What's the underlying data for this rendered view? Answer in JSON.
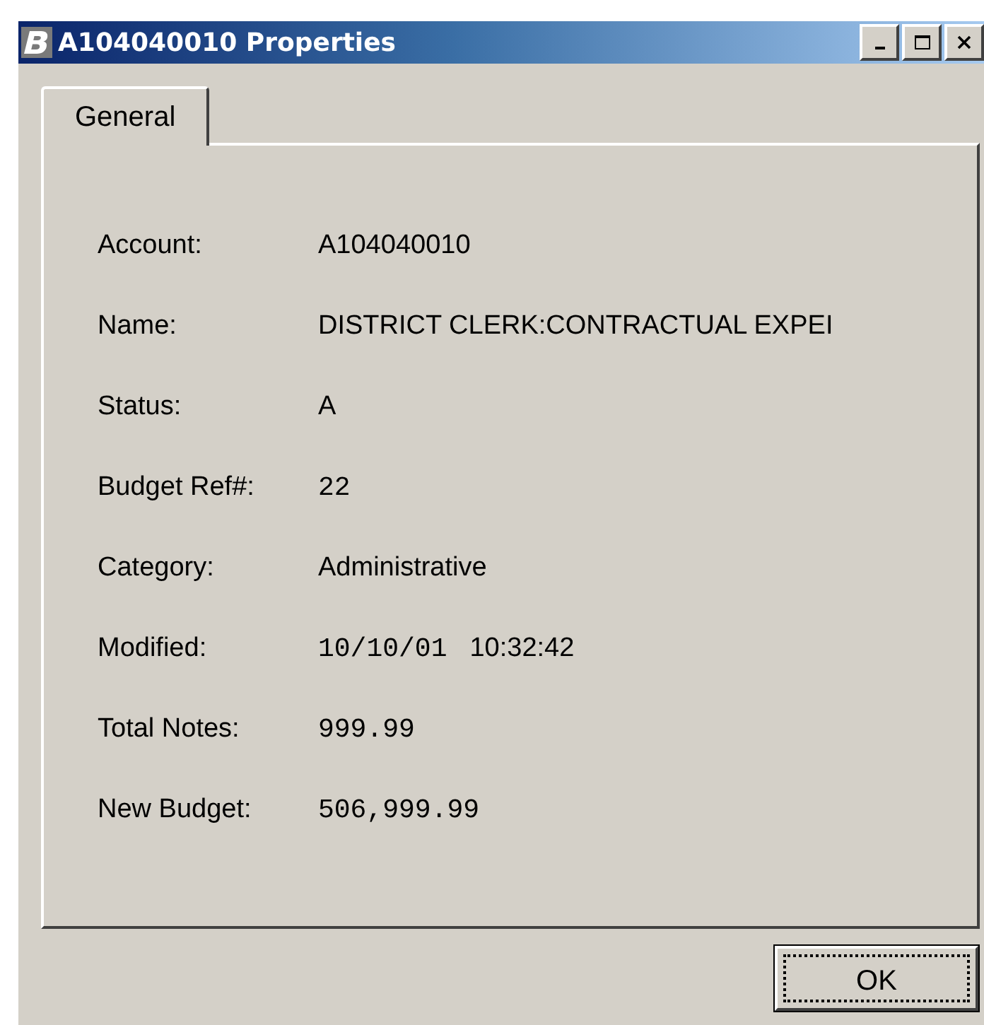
{
  "window": {
    "title": "A104040010 Properties"
  },
  "tabs": [
    {
      "label": "General",
      "selected": true
    }
  ],
  "fields": [
    {
      "label": "Account:",
      "values": [
        {
          "text": "A104040010",
          "kind": "sans"
        }
      ]
    },
    {
      "label": "Name:",
      "values": [
        {
          "text": "DISTRICT CLERK:CONTRACTUAL EXPEI",
          "kind": "sans"
        }
      ]
    },
    {
      "label": "Status:",
      "values": [
        {
          "text": "A",
          "kind": "sans"
        }
      ]
    },
    {
      "label": "Budget Ref#:",
      "values": [
        {
          "text": "22",
          "kind": "mono"
        }
      ]
    },
    {
      "label": "Category:",
      "values": [
        {
          "text": "Administrative",
          "kind": "sans"
        }
      ]
    },
    {
      "label": "Modified:",
      "values": [
        {
          "text": "10/10/01",
          "kind": "mono"
        },
        {
          "text": "10:32:42",
          "kind": "sans"
        }
      ]
    },
    {
      "label": "Total Notes:",
      "values": [
        {
          "text": "999.99",
          "kind": "mono"
        }
      ]
    },
    {
      "label": "New Budget:",
      "values": [
        {
          "text": "506,999.99",
          "kind": "mono"
        }
      ]
    }
  ],
  "buttons": [
    {
      "label": "OK",
      "focused": true
    }
  ]
}
